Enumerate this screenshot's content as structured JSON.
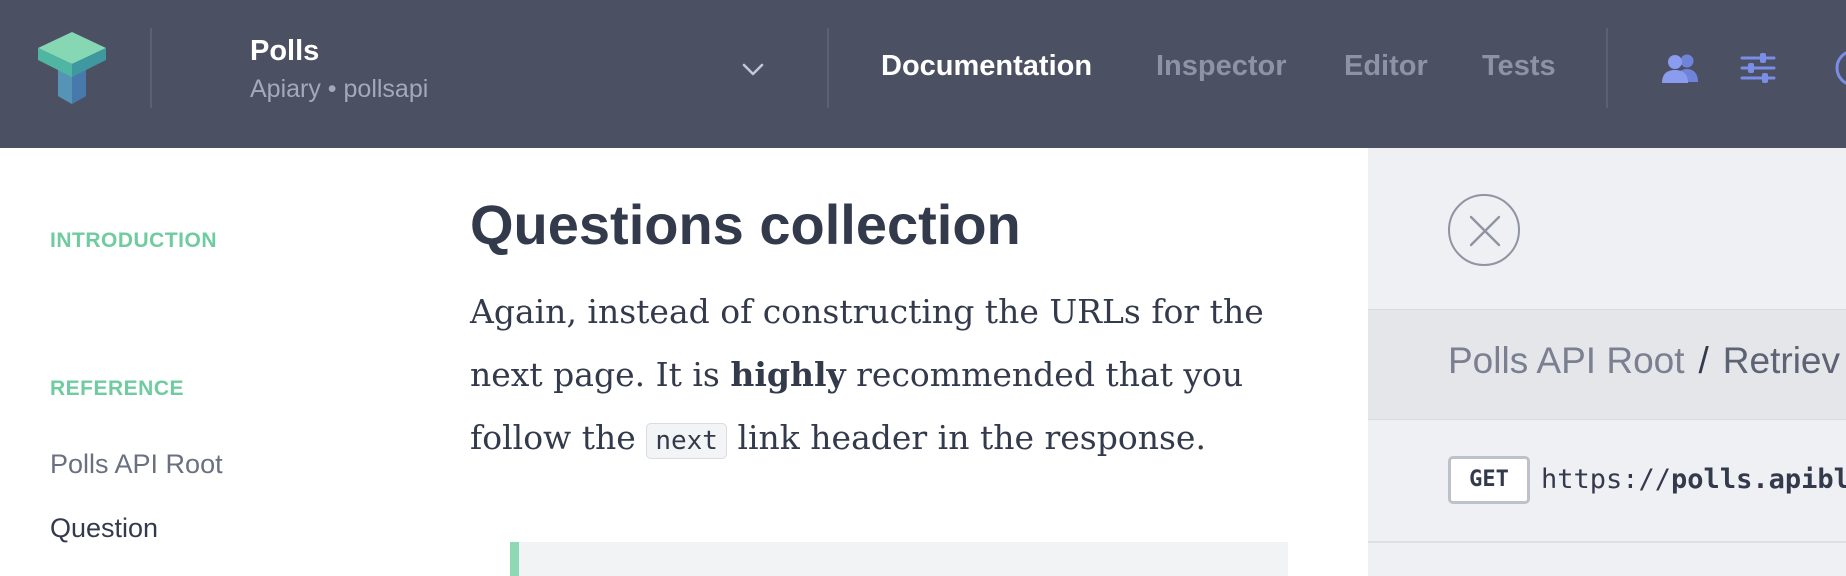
{
  "project": {
    "name": "Polls",
    "subtitle": "Apiary • pollsapi"
  },
  "tabs": [
    {
      "label": "Documentation",
      "active": true
    },
    {
      "label": "Inspector",
      "active": false
    },
    {
      "label": "Editor",
      "active": false
    },
    {
      "label": "Tests",
      "active": false
    }
  ],
  "toolbar_icons": [
    "team-icon",
    "settings-sliders-icon",
    "account-icon"
  ],
  "sidebar": {
    "sections": [
      {
        "label": "INTRODUCTION"
      },
      {
        "label": "REFERENCE"
      }
    ],
    "items": [
      {
        "label": "Polls API Root",
        "active": false
      },
      {
        "label": "Question",
        "active": true
      }
    ]
  },
  "doc": {
    "title": "Questions collection",
    "para_1": "Again, instead of constructing the URLs for the next page. It is ",
    "para_bold": "highly",
    "para_2": " recommended that you follow the ",
    "para_code": "next",
    "para_3": " link header in the response."
  },
  "panel": {
    "breadcrumb": {
      "root": "Polls API Root",
      "separator": "/",
      "current": "Retriev"
    },
    "method": "GET",
    "url_prefix": "https://",
    "url_host": "polls.apiblu"
  },
  "colors": {
    "topbar": "#4b5063",
    "accent_green": "#6fcca0",
    "text_dark": "#333a4b",
    "icon_blue": "#7b8ee6",
    "panel_bg": "#eff0f3"
  }
}
